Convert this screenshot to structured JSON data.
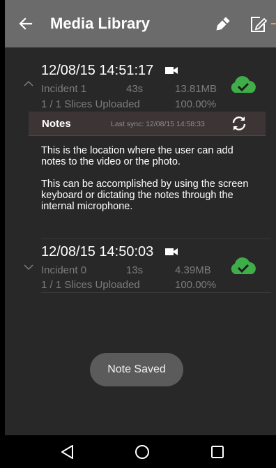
{
  "appbar": {
    "title": "Media Library",
    "back_icon": "arrow-left-icon",
    "pen_icon": "pen-icon",
    "edit_icon": "edit-note-icon",
    "accent_color": "#f4a21d"
  },
  "items": [
    {
      "datetime": "12/08/15 14:51:17",
      "media_icon": "video-camera-icon",
      "name": "Incident 1",
      "duration": "43s",
      "size": "13.81MB",
      "slices": "1 / 1 Slices Uploaded",
      "percent": "100.00%",
      "status_icon": "cloud-check-icon",
      "expanded": true
    },
    {
      "datetime": "12/08/15 14:50:03",
      "media_icon": "video-camera-icon",
      "name": "Incident 0",
      "duration": "13s",
      "size": "4.39MB",
      "slices": "1 / 1 Slices Uploaded",
      "percent": "100.00%",
      "status_icon": "cloud-check-icon",
      "expanded": false
    }
  ],
  "notes": {
    "label": "Notes",
    "last_sync": "Last sync: 12/08/15 14:58:33",
    "sync_icon": "sync-icon",
    "paragraphs": [
      "This is the location where the user can add notes to the video or the photo.",
      "This can be accomplished by using the screen keyboard or dictating the notes through the internal microphone."
    ]
  },
  "toast": {
    "text": "Note Saved"
  },
  "navbar": {
    "back": "triangle-back-icon",
    "home": "circle-home-icon",
    "recents": "square-recents-icon"
  },
  "colors": {
    "appbar": "#6b6b6b",
    "background": "#282828",
    "cloud_green": "#3fae49",
    "meta_text": "#7c7c7c"
  }
}
